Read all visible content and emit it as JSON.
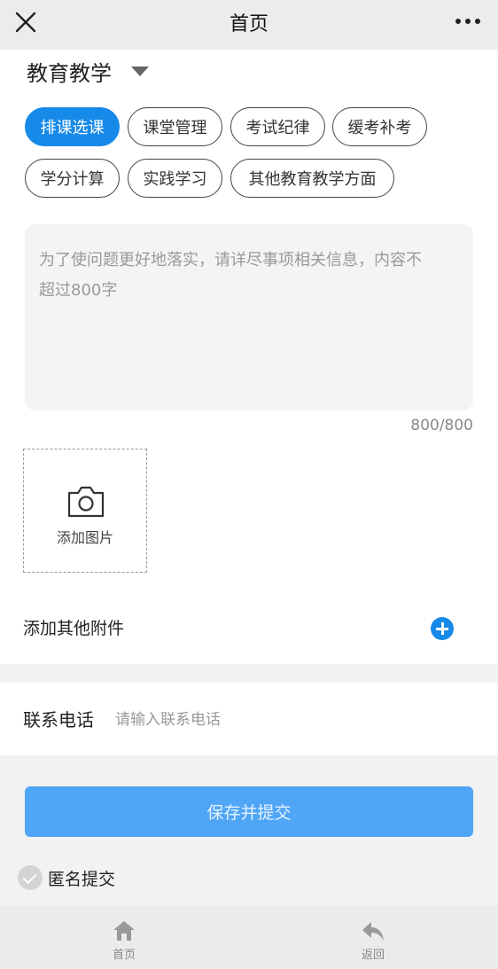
{
  "topbar": {
    "title": "首页",
    "close_icon": "close-icon",
    "more_icon": "more-icon"
  },
  "category": {
    "title": "教育教学",
    "caret_icon": "caret-down-icon"
  },
  "chips": [
    {
      "label": "排课选课",
      "active": true
    },
    {
      "label": "课堂管理",
      "active": false
    },
    {
      "label": "考试纪律",
      "active": false
    },
    {
      "label": "缓考补考",
      "active": false
    },
    {
      "label": "学分计算",
      "active": false
    },
    {
      "label": "实践学习",
      "active": false
    },
    {
      "label": "其他教育教学方面",
      "active": false
    }
  ],
  "description": {
    "placeholder_line1": "为了使问题更好地落实，请详尽事项相关信息，内容不",
    "placeholder_line2": "超过800字",
    "counter": "800/800"
  },
  "upload": {
    "label": "添加图片",
    "icon": "camera-icon"
  },
  "attachments": {
    "label": "添加其他附件",
    "icon": "plus-circle-icon"
  },
  "contact": {
    "label": "联系电话",
    "placeholder": "请输入联系电话"
  },
  "submit": {
    "label": "保存并提交"
  },
  "anonymous": {
    "label": "匿名提交",
    "checked": false
  },
  "bottom_nav": [
    {
      "label": "首页",
      "icon": "home-icon"
    },
    {
      "label": "返回",
      "icon": "back-icon"
    }
  ],
  "colors": {
    "accent": "#1789e8",
    "submit_bg": "#4fa6f6",
    "background": "#f2f2f2"
  }
}
